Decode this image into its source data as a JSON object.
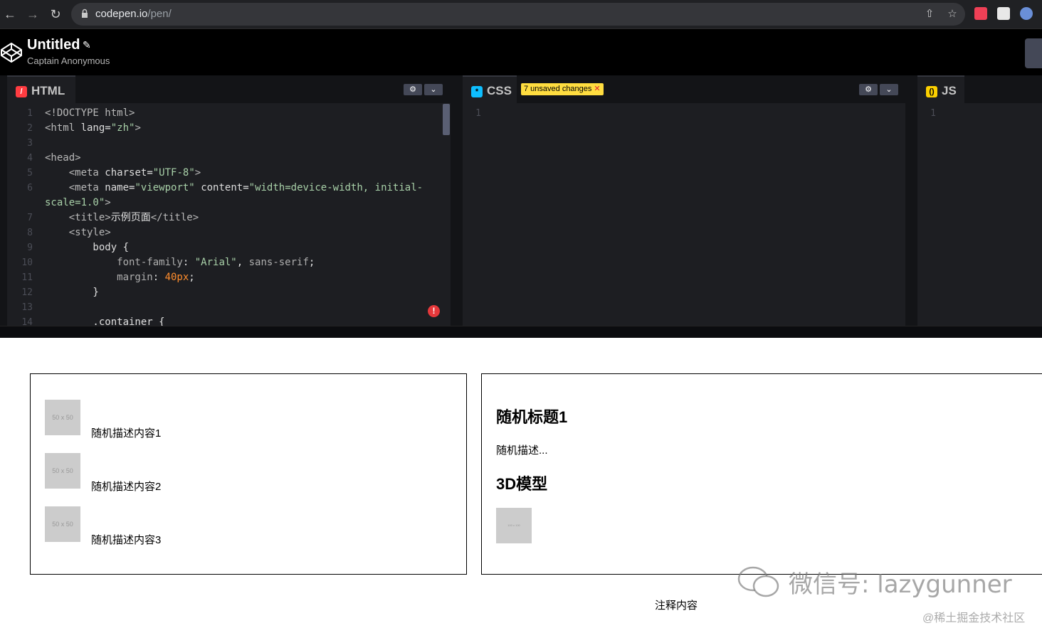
{
  "browser": {
    "url_host": "codepen.io",
    "url_path": "/pen/"
  },
  "header": {
    "title": "Untitled",
    "author": "Captain Anonymous"
  },
  "editors": {
    "html": {
      "label": "HTML",
      "lines": [
        {
          "n": "1",
          "parts": [
            {
              "c": "tag",
              "t": "<!DOCTYPE html>"
            }
          ]
        },
        {
          "n": "2",
          "parts": [
            {
              "c": "tag",
              "t": "<html "
            },
            {
              "c": "attr",
              "t": "lang"
            },
            {
              "c": "plain",
              "t": "="
            },
            {
              "c": "str",
              "t": "\"zh\""
            },
            {
              "c": "tag",
              "t": ">"
            }
          ]
        },
        {
          "n": "3",
          "parts": []
        },
        {
          "n": "4",
          "parts": [
            {
              "c": "tag",
              "t": "<head>"
            }
          ]
        },
        {
          "n": "5",
          "parts": [
            {
              "c": "tag",
              "t": "    <meta "
            },
            {
              "c": "attr",
              "t": "charset"
            },
            {
              "c": "plain",
              "t": "="
            },
            {
              "c": "str",
              "t": "\"UTF-8\""
            },
            {
              "c": "tag",
              "t": ">"
            }
          ]
        },
        {
          "n": "6",
          "parts": [
            {
              "c": "tag",
              "t": "    <meta "
            },
            {
              "c": "attr",
              "t": "name"
            },
            {
              "c": "plain",
              "t": "="
            },
            {
              "c": "str",
              "t": "\"viewport\""
            },
            {
              "c": "plain",
              "t": " "
            },
            {
              "c": "attr",
              "t": "content"
            },
            {
              "c": "plain",
              "t": "="
            },
            {
              "c": "str",
              "t": "\"width=device-width, initial-"
            }
          ]
        },
        {
          "n": "",
          "parts": [
            {
              "c": "str",
              "t": "scale=1.0\""
            },
            {
              "c": "tag",
              "t": ">"
            }
          ]
        },
        {
          "n": "7",
          "parts": [
            {
              "c": "tag",
              "t": "    <title>"
            },
            {
              "c": "plain",
              "t": "示例页面"
            },
            {
              "c": "tag",
              "t": "</title>"
            }
          ]
        },
        {
          "n": "8",
          "parts": [
            {
              "c": "tag",
              "t": "    <style>"
            }
          ]
        },
        {
          "n": "9",
          "parts": [
            {
              "c": "attr",
              "t": "        body "
            },
            {
              "c": "plain",
              "t": "{"
            }
          ]
        },
        {
          "n": "10",
          "parts": [
            {
              "c": "prop",
              "t": "            font-family"
            },
            {
              "c": "plain",
              "t": ": "
            },
            {
              "c": "str",
              "t": "\"Arial\""
            },
            {
              "c": "plain",
              "t": ", "
            },
            {
              "c": "prop",
              "t": "sans-serif"
            },
            {
              "c": "plain",
              "t": ";"
            }
          ]
        },
        {
          "n": "11",
          "parts": [
            {
              "c": "prop",
              "t": "            margin"
            },
            {
              "c": "plain",
              "t": ": "
            },
            {
              "c": "num",
              "t": "40px"
            },
            {
              "c": "plain",
              "t": ";"
            }
          ]
        },
        {
          "n": "12",
          "parts": [
            {
              "c": "plain",
              "t": "        }"
            }
          ]
        },
        {
          "n": "13",
          "parts": []
        },
        {
          "n": "14",
          "parts": [
            {
              "c": "plain",
              "t": "        .container {"
            }
          ]
        }
      ]
    },
    "css": {
      "label": "CSS",
      "unsaved": "7 unsaved changes",
      "line_numbers": [
        "1"
      ]
    },
    "js": {
      "label": "JS",
      "line_numbers": [
        "1"
      ]
    }
  },
  "preview": {
    "list_items": [
      {
        "thumb": "50 x 50",
        "text": "随机描述内容1"
      },
      {
        "thumb": "50 x 50",
        "text": "随机描述内容2"
      },
      {
        "thumb": "50 x 50",
        "text": "随机描述内容3"
      }
    ],
    "heading1": "随机标题1",
    "description": "随机描述...",
    "heading2": "3D模型",
    "model_thumb": "100 x 100",
    "footer_note": "注释内容"
  },
  "watermark": {
    "text": "微信号: lazygunner",
    "source": "@稀土掘金技术社区"
  },
  "colors": {
    "html_icon": "#ff3c41",
    "css_icon": "#0ebeff",
    "js_icon": "#fcd000",
    "unsaved_badge": "#ffdd40"
  }
}
